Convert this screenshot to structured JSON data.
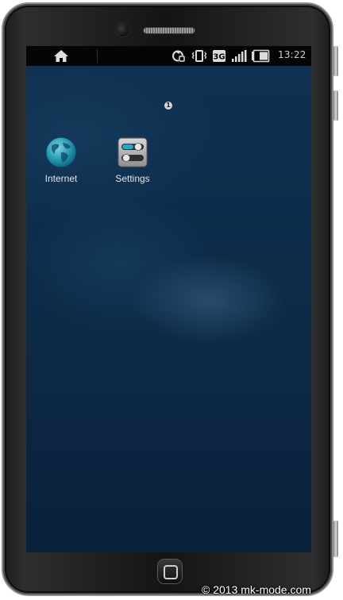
{
  "status_bar": {
    "time": "13:22",
    "icons": [
      "home-icon",
      "sync-icon",
      "vibrate-icon",
      "network-3g-icon",
      "signal-icon",
      "battery-icon"
    ],
    "network_label": "3G"
  },
  "home_screen": {
    "page_indicator": "1",
    "apps": [
      {
        "label": "Internet",
        "icon": "globe-icon"
      },
      {
        "label": "Settings",
        "icon": "settings-toggle-icon"
      }
    ]
  },
  "watermark": "© 2013 mk-mode.com",
  "colors": {
    "wallpaper": "#0e2c4a",
    "status_bar": "#050505",
    "phone_body": "#141414"
  }
}
